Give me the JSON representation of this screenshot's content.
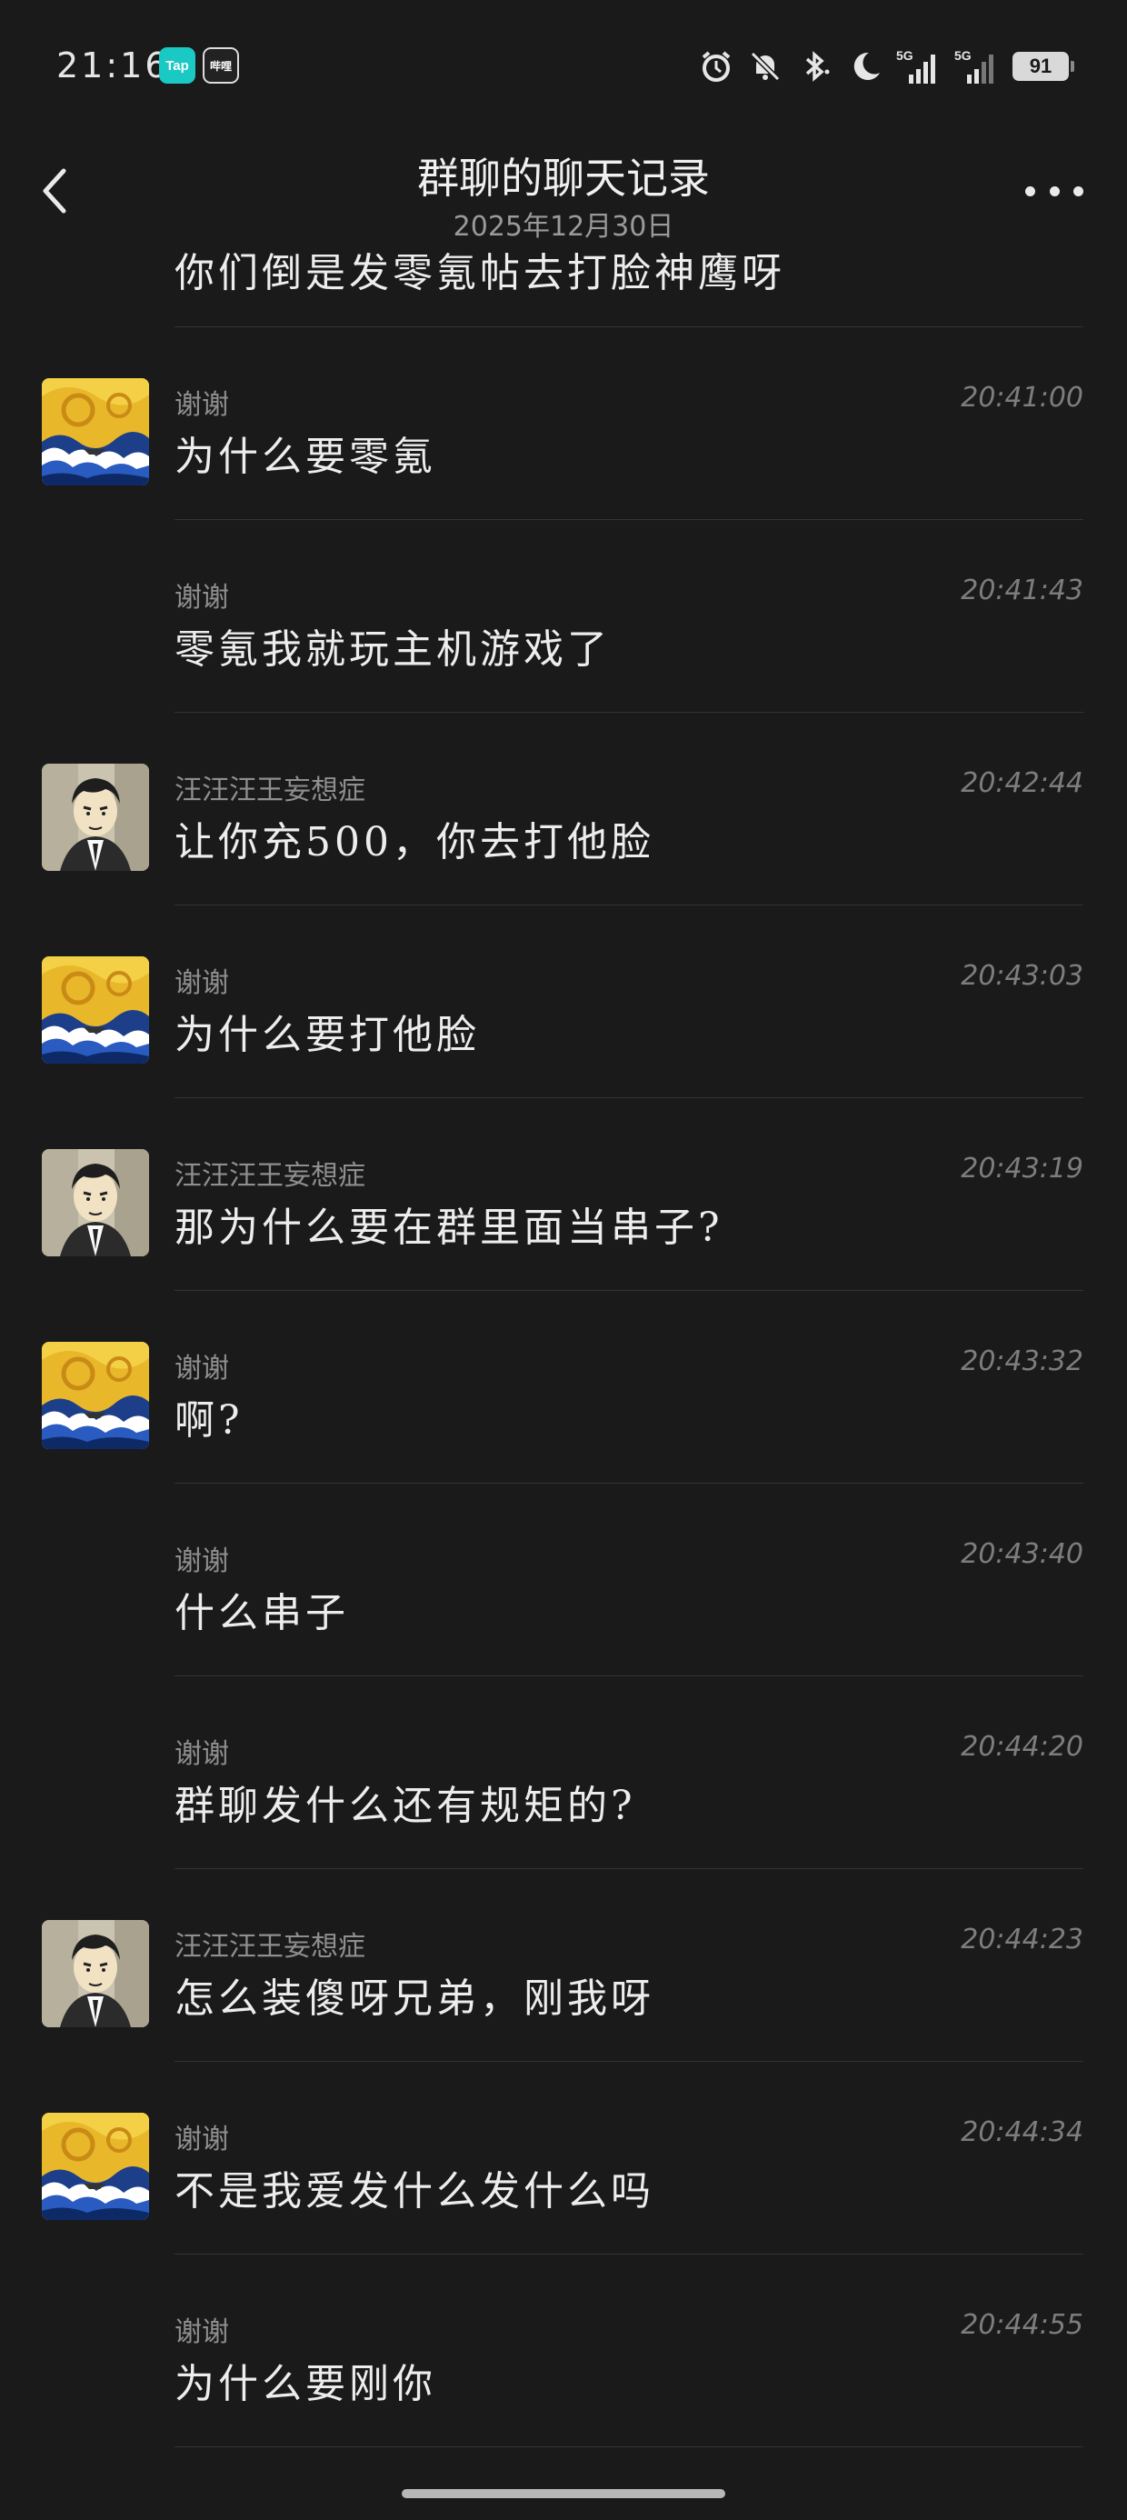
{
  "status_bar": {
    "time": "21:16",
    "app_badges": [
      "Tap",
      "哔哩"
    ],
    "icons": [
      "alarm-icon",
      "bell-off-icon",
      "bluetooth-icon",
      "moon-icon",
      "signal-5g-1-icon",
      "signal-5g-2-icon"
    ],
    "network_1": "5G",
    "network_2": "5G",
    "battery": "91"
  },
  "header": {
    "title": "群聊的聊天记录",
    "subtitle": "2025年12月30日",
    "back_icon": "chevron-left-icon",
    "more_icon": "more-horizontal-icon"
  },
  "partial_message": {
    "content": "你们倒是发零氪帖去打脸神鹰呀"
  },
  "messages": [
    {
      "sender": "谢谢",
      "time": "20:41:00",
      "content": "为什么要零氪",
      "avatar": "starry-wave"
    },
    {
      "sender": "谢谢",
      "time": "20:41:43",
      "content": "零氪我就玩主机游戏了",
      "avatar": ""
    },
    {
      "sender": "汪汪汪王妄想症",
      "time": "20:42:44",
      "content": "让你充500，你去打他脸",
      "avatar": "cartoon-man"
    },
    {
      "sender": "谢谢",
      "time": "20:43:03",
      "content": "为什么要打他脸",
      "avatar": "starry-wave"
    },
    {
      "sender": "汪汪汪王妄想症",
      "time": "20:43:19",
      "content": "那为什么要在群里面当串子?",
      "avatar": "cartoon-man"
    },
    {
      "sender": "谢谢",
      "time": "20:43:32",
      "content": "啊?",
      "avatar": "starry-wave"
    },
    {
      "sender": "谢谢",
      "time": "20:43:40",
      "content": "什么串子",
      "avatar": ""
    },
    {
      "sender": "谢谢",
      "time": "20:44:20",
      "content": "群聊发什么还有规矩的?",
      "avatar": ""
    },
    {
      "sender": "汪汪汪王妄想症",
      "time": "20:44:23",
      "content": "怎么装傻呀兄弟，刚我呀",
      "avatar": "cartoon-man"
    },
    {
      "sender": "谢谢",
      "time": "20:44:34",
      "content": "不是我爱发什么发什么吗",
      "avatar": "starry-wave"
    },
    {
      "sender": "谢谢",
      "time": "20:44:55",
      "content": "为什么要刚你",
      "avatar": ""
    }
  ],
  "colors": {
    "background": "#1a1a1a",
    "text": "#ededed",
    "secondary": "#8f8f8f",
    "divider": "#333333"
  }
}
